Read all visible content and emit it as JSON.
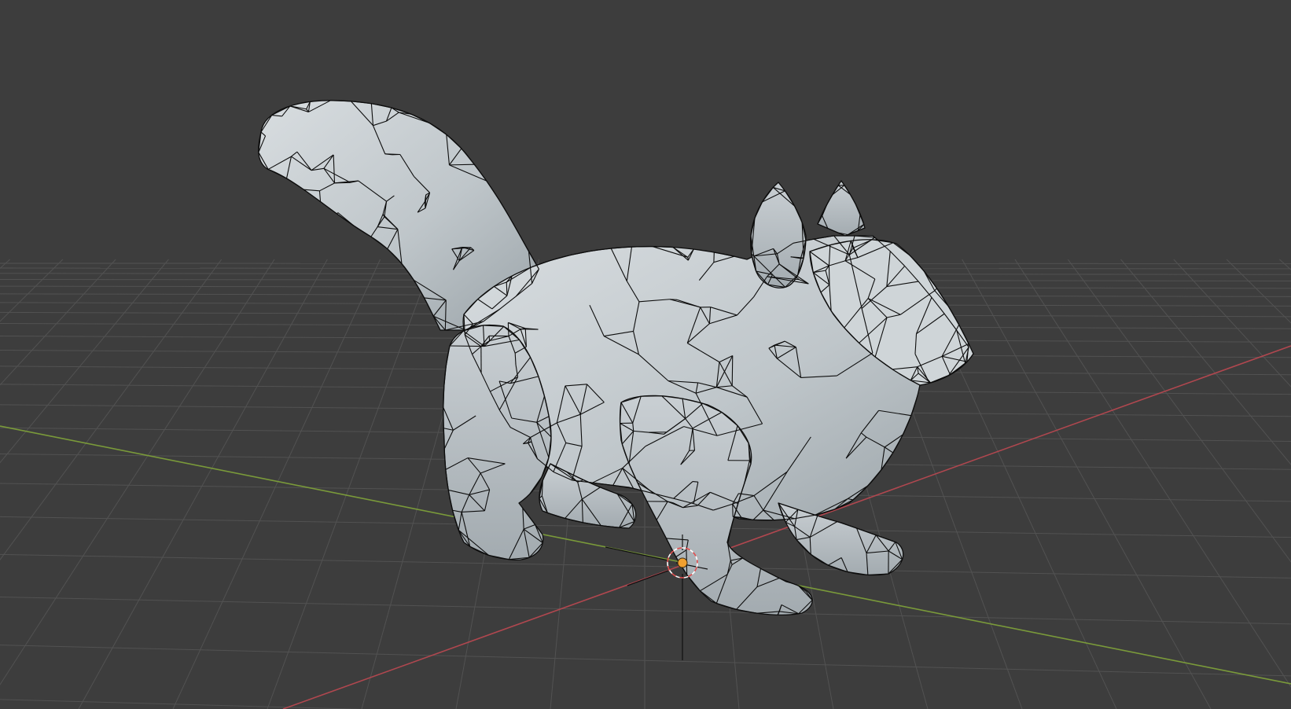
{
  "viewport": {
    "view": "3D Viewport",
    "shading": "solid",
    "overlay_wireframe": true
  },
  "scene": {
    "object": "squirrel",
    "object_kind": "triangulated low-poly mesh"
  },
  "axes": {
    "x_axis_color": "#b0474f",
    "y_axis_color": "#7a9a3a"
  },
  "colors": {
    "background": "#3d3d3d",
    "grid": "#525252",
    "mesh_fill": "#c3c9cd",
    "mesh_wire": "#0d0d0d",
    "origin_dot": "#f0a030",
    "cursor_ring_a": "#e05050",
    "cursor_ring_b": "#ffffff"
  }
}
